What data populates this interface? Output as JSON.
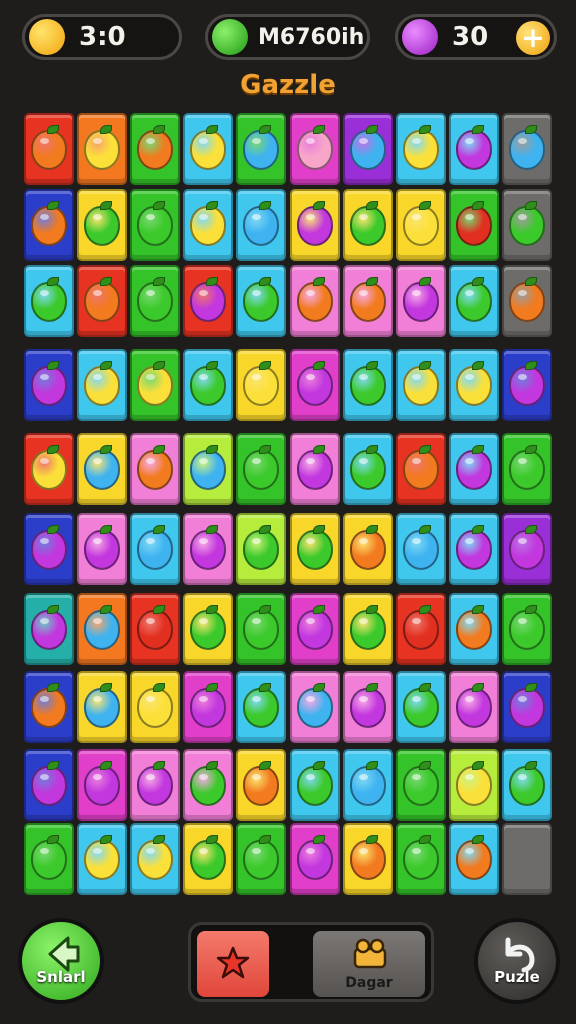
{
  "hud": {
    "score": "3:0",
    "moves_label": "M6760ih",
    "gems": "30",
    "plus_symbol": "+",
    "score_icon": "lemon-icon",
    "moves_icon": "lime-icon",
    "gems_icon": "plum-icon"
  },
  "title": "Gazzle",
  "colors": {
    "red": "#e63322",
    "orange": "#f3781f",
    "yellow": "#f9d72a",
    "green": "#34c42a",
    "lime": "#b6ec3c",
    "cyan": "#3fc7ee",
    "teal": "#24b0a8",
    "blue": "#2b3ec9",
    "magenta": "#e13fc9",
    "pink": "#f27fd7",
    "purple": "#9a2fd8",
    "gray": "#6d6c6b"
  },
  "fruit_colors": {
    "orange": "#f27a1f",
    "yellow": "#fbe03a",
    "green": "#3cc92b",
    "blue": "#3fb3f0",
    "purple": "#c237de",
    "red": "#e23020",
    "pink": "#f7a6c9"
  },
  "board": {
    "rows": [
      [
        [
          "red",
          "orange"
        ],
        [
          "orange",
          "yellow"
        ],
        [
          "green",
          "orange"
        ],
        [
          "cyan",
          "yellow"
        ],
        [
          "green",
          "blue"
        ],
        [
          "magenta",
          "pink"
        ],
        [
          "purple",
          "blue"
        ],
        [
          "cyan",
          "yellow"
        ],
        [
          "cyan",
          "purple"
        ],
        [
          "gray",
          "blue"
        ]
      ],
      [
        [
          "blue",
          "orange"
        ],
        [
          "yellow",
          "green"
        ],
        [
          "green",
          "green"
        ],
        [
          "cyan",
          "yellow"
        ],
        [
          "cyan",
          "blue"
        ],
        [
          "yellow",
          "purple"
        ],
        [
          "yellow",
          "green"
        ],
        [
          "yellow",
          "yellow"
        ],
        [
          "green",
          "red"
        ],
        [
          "gray",
          "green"
        ]
      ],
      [
        [
          "cyan",
          "green"
        ],
        [
          "red",
          "orange"
        ],
        [
          "green",
          "green"
        ],
        [
          "red",
          "purple"
        ],
        [
          "cyan",
          "green"
        ],
        [
          "pink",
          "orange"
        ],
        [
          "pink",
          "orange"
        ],
        [
          "pink",
          "purple"
        ],
        [
          "cyan",
          "green"
        ],
        [
          "gray",
          "orange"
        ]
      ],
      [
        [
          "blue",
          "purple"
        ],
        [
          "cyan",
          "yellow"
        ],
        [
          "green",
          "yellow"
        ],
        [
          "cyan",
          "green"
        ],
        [
          "yellow",
          "yellow"
        ],
        [
          "magenta",
          "purple"
        ],
        [
          "cyan",
          "green"
        ],
        [
          "cyan",
          "yellow"
        ],
        [
          "cyan",
          "yellow"
        ],
        [
          "blue",
          "purple"
        ]
      ],
      [
        [
          "red",
          "yellow"
        ],
        [
          "yellow",
          "blue"
        ],
        [
          "pink",
          "orange"
        ],
        [
          "lime",
          "blue"
        ],
        [
          "green",
          "green"
        ],
        [
          "pink",
          "purple"
        ],
        [
          "cyan",
          "green"
        ],
        [
          "red",
          "orange"
        ],
        [
          "cyan",
          "purple"
        ],
        [
          "green",
          "green"
        ]
      ],
      [
        [
          "blue",
          "purple"
        ],
        [
          "pink",
          "purple"
        ],
        [
          "cyan",
          "blue"
        ],
        [
          "pink",
          "purple"
        ],
        [
          "lime",
          "green"
        ],
        [
          "yellow",
          "green"
        ],
        [
          "yellow",
          "orange"
        ],
        [
          "cyan",
          "blue"
        ],
        [
          "cyan",
          "purple"
        ],
        [
          "purple",
          "purple"
        ]
      ],
      [
        [
          "teal",
          "purple"
        ],
        [
          "orange",
          "blue"
        ],
        [
          "red",
          "red"
        ],
        [
          "yellow",
          "green"
        ],
        [
          "green",
          "green"
        ],
        [
          "magenta",
          "purple"
        ],
        [
          "yellow",
          "green"
        ],
        [
          "red",
          "red"
        ],
        [
          "cyan",
          "orange"
        ],
        [
          "green",
          "green"
        ]
      ],
      [
        [
          "blue",
          "orange"
        ],
        [
          "yellow",
          "blue"
        ],
        [
          "yellow",
          "yellow"
        ],
        [
          "magenta",
          "purple"
        ],
        [
          "cyan",
          "green"
        ],
        [
          "pink",
          "blue"
        ],
        [
          "pink",
          "purple"
        ],
        [
          "cyan",
          "green"
        ],
        [
          "pink",
          "purple"
        ],
        [
          "blue",
          "purple"
        ]
      ],
      [
        [
          "blue",
          "purple"
        ],
        [
          "magenta",
          "purple"
        ],
        [
          "pink",
          "purple"
        ],
        [
          "pink",
          "green"
        ],
        [
          "yellow",
          "orange"
        ],
        [
          "cyan",
          "green"
        ],
        [
          "cyan",
          "blue"
        ],
        [
          "green",
          "green"
        ],
        [
          "lime",
          "yellow"
        ],
        [
          "cyan",
          "green"
        ]
      ],
      [
        [
          "green",
          "green"
        ],
        [
          "cyan",
          "yellow"
        ],
        [
          "cyan",
          "yellow"
        ],
        [
          "yellow",
          "green"
        ],
        [
          "green",
          "green"
        ],
        [
          "magenta",
          "purple"
        ],
        [
          "yellow",
          "orange"
        ],
        [
          "green",
          "green"
        ],
        [
          "cyan",
          "orange"
        ],
        [
          "gray",
          ""
        ]
      ]
    ]
  },
  "buttons": {
    "start_label": "Snlarl",
    "dagar_label": "Dagar",
    "puzzle_label": "Puzle",
    "start_icon": "back-arrow-icon",
    "hint_icon": "star-icon",
    "dagar_icon": "camel-icon",
    "puzzle_icon": "undo-arrow-icon"
  }
}
